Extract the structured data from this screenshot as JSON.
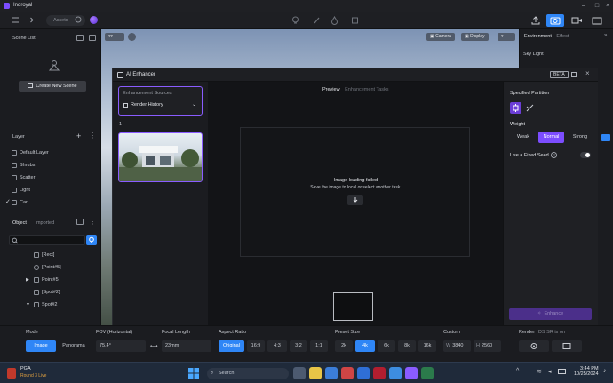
{
  "app": {
    "title": "Indroyal"
  },
  "toolbar": {
    "assets_label": "Assets"
  },
  "left_panel": {
    "scene_list_label": "Scene List",
    "create_scene_label": "Create New Scene",
    "layer_label": "Layer",
    "layers": [
      {
        "label": "Default Layer"
      },
      {
        "label": "Shrubs"
      },
      {
        "label": "Scatter"
      },
      {
        "label": "Light"
      },
      {
        "label": "Car"
      }
    ],
    "object_tabs": [
      {
        "label": "Object"
      },
      {
        "label": "Imported"
      }
    ],
    "objects": [
      {
        "label": "[Rect]"
      },
      {
        "label": "[Point#5]"
      },
      {
        "label": "Point#5"
      },
      {
        "label": "[Spot#2]"
      },
      {
        "label": "Spot#2"
      }
    ]
  },
  "viewport": {
    "camera_label": "Camera",
    "display_label": "Display"
  },
  "right_panel": {
    "tabs": [
      {
        "label": "Environment"
      },
      {
        "label": "Effect"
      }
    ],
    "sky_light_label": "Sky Light"
  },
  "dialog": {
    "title": "AI Enhancer",
    "beta_badge": "BETA",
    "sources_label": "Enhancement Sources",
    "source_value": "Render History",
    "history_index": "1",
    "tabs": [
      {
        "label": "Preview"
      },
      {
        "label": "Enhancement Tasks"
      }
    ],
    "error_title": "Image loading failed",
    "error_subtitle": "Save the image to local or select another task.",
    "specified_partition_label": "Specified Partition",
    "weight_label": "Weight",
    "weights": [
      {
        "label": "Weak"
      },
      {
        "label": "Normal"
      },
      {
        "label": "Strong"
      }
    ],
    "fixed_seed_label": "Use a Fixed Seed",
    "enhance_label": "Enhance"
  },
  "bottom": {
    "mode_label": "Mode",
    "modes": [
      {
        "label": "Image"
      },
      {
        "label": "Panorama"
      }
    ],
    "fov_label": "FOV (Horizontal)",
    "fov_value": "75.4°",
    "focal_label": "Focal Length",
    "focal_value": "23mm",
    "aspect_label": "Aspect Ratio",
    "aspects": [
      {
        "label": "Original"
      },
      {
        "label": "16:9"
      },
      {
        "label": "4:3"
      },
      {
        "label": "3:2"
      },
      {
        "label": "1:1"
      }
    ],
    "preset_label": "Preset Size",
    "presets": [
      {
        "label": "2k"
      },
      {
        "label": "4k"
      },
      {
        "label": "6k"
      },
      {
        "label": "8k"
      },
      {
        "label": "16k"
      }
    ],
    "custom_label": "Custom",
    "custom_w_label": "W",
    "custom_w": "3840",
    "custom_h_label": "H",
    "custom_h": "2560",
    "render_label": "Render",
    "render_note": "DS SR is on"
  },
  "taskbar": {
    "news_title": "PGA",
    "news_subtitle": "Round 3 Live",
    "search_placeholder": "Search",
    "time": "3:44 PM",
    "date": "10/25/2024"
  },
  "colors": {
    "accent_blue": "#2f86f6",
    "accent_purple": "#7c4dff",
    "panel_bg": "#1b1c20"
  }
}
